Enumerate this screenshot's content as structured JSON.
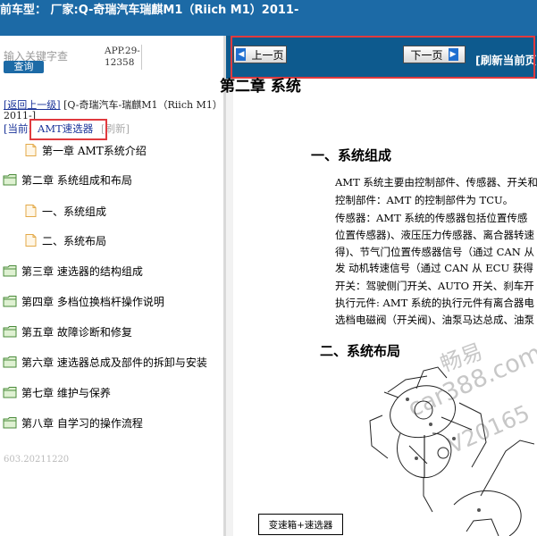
{
  "header": {
    "title": "前车型： 厂家:Q-奇瑞汽车瑞麒M1（Riich M1）2011-"
  },
  "sidebar": {
    "search": {
      "placeholder": "输入关键字查",
      "button_label": "查询"
    },
    "app_version": "APP.29-12358",
    "back_link": "[返回上一级]",
    "vehicle_path": "[Q-奇瑞汽车-瑞麒M1（Riich M1）2011-]",
    "current_label": "[当前:",
    "current_item": "AMT速选器",
    "refresh_label": "[刷新]",
    "tree": [
      {
        "type": "doc",
        "level": 1,
        "label": "第一章 AMT系统介绍"
      },
      {
        "type": "folder",
        "level": 0,
        "label": "第二章 系统组成和布局"
      },
      {
        "type": "doc",
        "level": 1,
        "label": "一、系统组成"
      },
      {
        "type": "doc",
        "level": 1,
        "label": "二、系统布局"
      },
      {
        "type": "folder",
        "level": 0,
        "label": "第三章 速选器的结构组成"
      },
      {
        "type": "folder",
        "level": 0,
        "label": "第四章 多档位换档杆操作说明"
      },
      {
        "type": "folder",
        "level": 0,
        "label": "第五章 故障诊断和修复"
      },
      {
        "type": "folder",
        "level": 0,
        "label": "第六章 速选器总成及部件的拆卸与安装"
      },
      {
        "type": "folder",
        "level": 0,
        "label": "第七章 维护与保养"
      },
      {
        "type": "folder",
        "level": 0,
        "label": "第八章 自学习的操作流程"
      }
    ],
    "footer": "603.20211220"
  },
  "viewer": {
    "prev_label": "上一页",
    "next_label": "下一页",
    "refresh_page_label": "[刷新当前页",
    "doc": {
      "chapter_title": "第二章 系统",
      "section1": "一、系统组成",
      "paragraphs": [
        "AMT 系统主要由控制部件、传感器、开关和",
        "控制部件：AMT 的控制部件为 TCU。",
        "传感器：AMT 系统的传感器包括位置传感",
        "位置传感器)、液压压力传感器、离合器转速",
        "得)、节气门位置传感器信号（通过 CAN 从",
        "发 动机转速信号（通过 CAN 从 ECU 获得",
        "开关：驾驶侧门开关、AUTO 开关、刹车开",
        "执行元件: AMT 系统的执行元件有离合器电",
        "选档电磁阀（开关阀)、油泵马达总成、油泵"
      ],
      "section2": "二、系统布局",
      "diagram_label": "变速箱+速选器"
    },
    "watermarks": [
      "畅易",
      "car388.com",
      "V20165"
    ]
  }
}
